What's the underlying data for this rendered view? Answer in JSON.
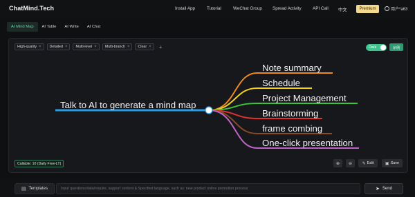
{
  "app": {
    "logo": "ChatMind.Tech"
  },
  "nav": {
    "items": [
      {
        "label": "Install App"
      },
      {
        "label": "Tutorial"
      },
      {
        "label": "WeChat Group"
      },
      {
        "label": "Spread Activity"
      },
      {
        "label": "API Call"
      },
      {
        "label": "中文"
      }
    ],
    "premium_label": "Premium",
    "user_label": "用户*a63"
  },
  "tabs": [
    {
      "label": "AI Mind Map",
      "active": true
    },
    {
      "label": "AI Table"
    },
    {
      "label": "AI Write"
    },
    {
      "label": "AI Chat"
    }
  ],
  "chips": [
    {
      "label": "High-quality"
    },
    {
      "label": "Detailed"
    },
    {
      "label": "Multi-level"
    },
    {
      "label": "Multi-branch"
    },
    {
      "label": "Clear"
    }
  ],
  "theme_toggle": {
    "label": "Dark",
    "on": true
  },
  "lang_button": {
    "label": "示例"
  },
  "mindmap": {
    "root": "Talk to AI to generate a mind map",
    "branches": [
      {
        "label": "Note summary",
        "color": "#f08a1c"
      },
      {
        "label": "Schedule",
        "color": "#f2d21c"
      },
      {
        "label": "Project Management",
        "color": "#3cc43c"
      },
      {
        "label": "Brainstorming",
        "color": "#e03030"
      },
      {
        "label": "frame combing",
        "color": "#8a4a24"
      },
      {
        "label": "One-click presentation",
        "color": "#c064c8"
      }
    ],
    "root_color": "#2b9be6"
  },
  "callable": "Callable: 10 (Daily Free-LT)",
  "toolbar": {
    "zoom_in_label": "⊕",
    "zoom_out_label": "⊖",
    "edit_label": "Edit",
    "save_label": "Save"
  },
  "composer": {
    "templates_label": "Templates",
    "placeholder": "Input questions/data/require, support content & Specified language, such as: new product online promotion process",
    "send_label": "Send"
  }
}
